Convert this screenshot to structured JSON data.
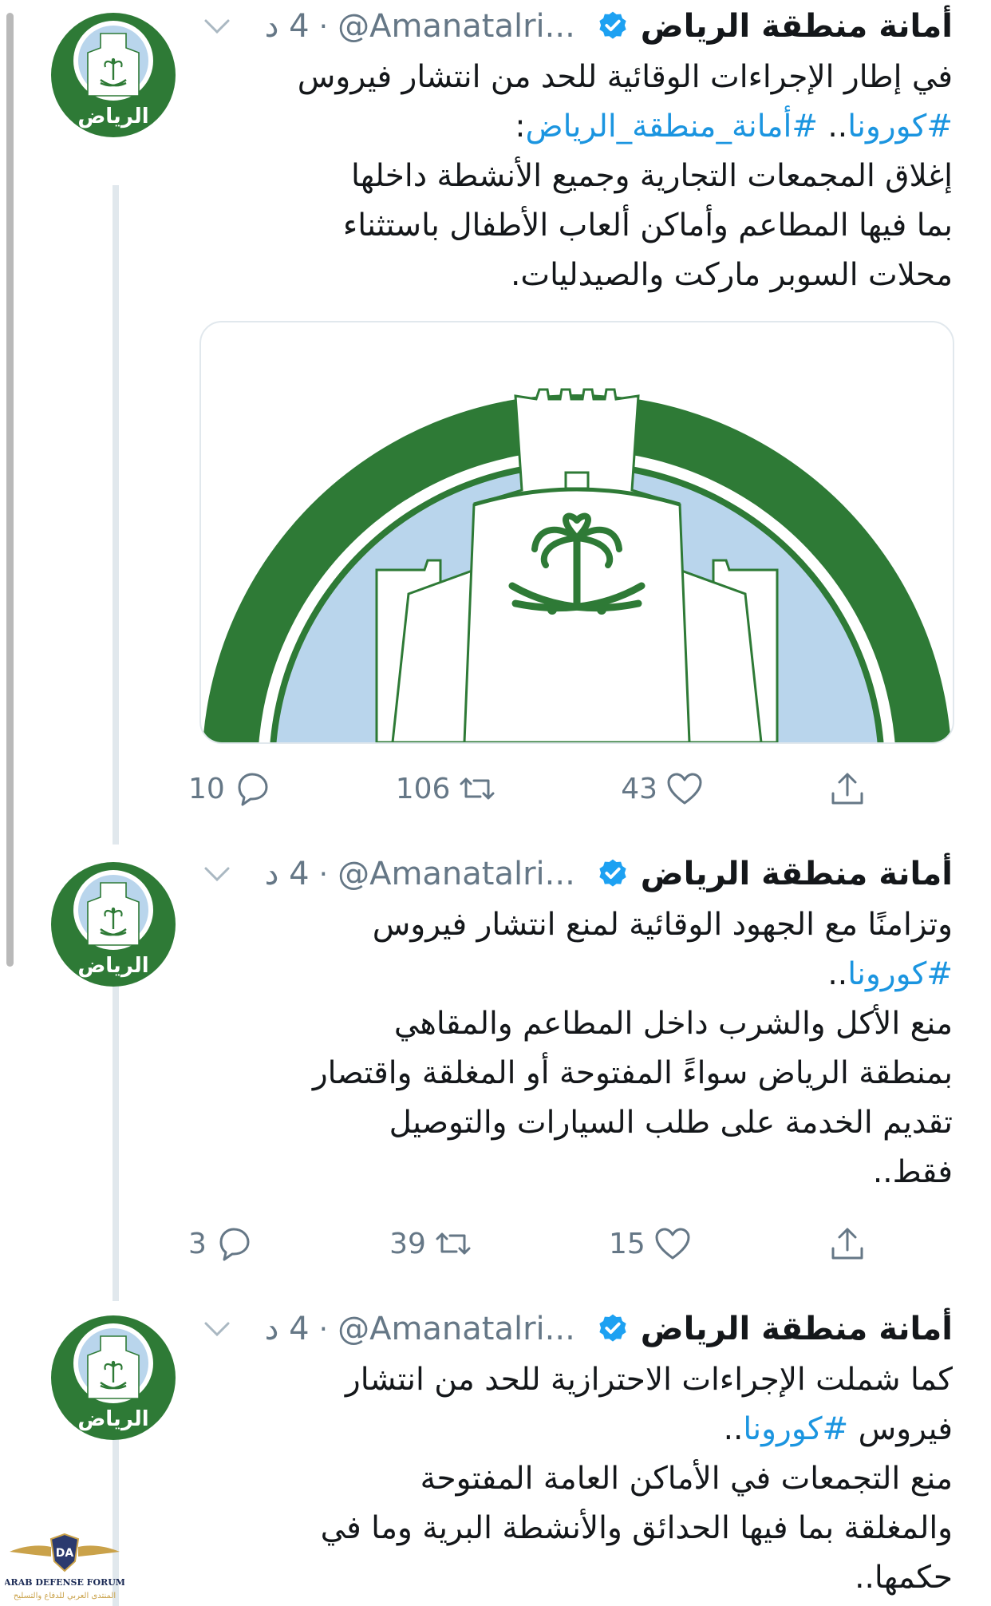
{
  "tweets": [
    {
      "name": "أمانة منطقة الرياض",
      "handle": "@Amanatalri...",
      "dot": "·",
      "time": "4 د",
      "avatar_text": "الرياض",
      "body_lines": [
        {
          "text": "في إطار الإجراءات الوقائية للحد من انتشار فيروس"
        },
        {
          "hashtags": [
            "#كورونا",
            "#أمانة_منطقة_الرياض"
          ],
          "sep": "..",
          "tail": ":"
        },
        {
          "text": "إغلاق المجمعات التجارية وجميع الأنشطة داخلها"
        },
        {
          "text": "بما فيها المطاعم وأماكن ألعاب الأطفال باستثناء"
        },
        {
          "text": "محلات السوبر ماركت والصيدليات."
        }
      ],
      "replies": "10",
      "retweets": "106",
      "likes": "43"
    },
    {
      "name": "أمانة منطقة الرياض",
      "handle": "@Amanatalri...",
      "dot": "·",
      "time": "4 د",
      "avatar_text": "الرياض",
      "body_lines": [
        {
          "text": "وتزامنًا مع الجهود الوقائية لمنع انتشار فيروس"
        },
        {
          "hashtag": "#كورونا",
          "tail": ".."
        },
        {
          "text": "منع الأكل والشرب داخل المطاعم والمقاهي"
        },
        {
          "text": "بمنطقة الرياض سواءً المفتوحة أو المغلقة واقتصار"
        },
        {
          "text": "تقديم الخدمة على طلب السيارات والتوصيل"
        },
        {
          "text": "فقط.."
        }
      ],
      "replies": "3",
      "retweets": "39",
      "likes": "15"
    },
    {
      "name": "أمانة منطقة الرياض",
      "handle": "@Amanatalri...",
      "dot": "·",
      "time": "4 د",
      "avatar_text": "الرياض",
      "body_lines": [
        {
          "text": "كما شملت الإجراءات الاحترازية للحد من انتشار"
        },
        {
          "lead": "فيروس",
          "hashtag": "#كورونا",
          "tail": ".."
        },
        {
          "text": "منع التجمعات في الأماكن العامة المفتوحة"
        },
        {
          "text": "والمغلقة بما فيها الحدائق والأنشطة البرية وما في"
        },
        {
          "text": "حكمها.."
        }
      ]
    }
  ],
  "watermark": {
    "badge": "DA",
    "line1": "ARAB DEFENSE FORUM",
    "line2": "المنتدى العربي للدفاع والتسليح"
  },
  "icons": [
    "verified-badge-icon",
    "chevron-down-icon",
    "reply-icon",
    "retweet-icon",
    "like-icon",
    "share-icon"
  ],
  "colors": {
    "link": "#1b95e0",
    "verified": "#1da1f2",
    "logo_green": "#2e7a36",
    "logo_sky": "#b9d5ec",
    "meta_gray": "#657786"
  }
}
